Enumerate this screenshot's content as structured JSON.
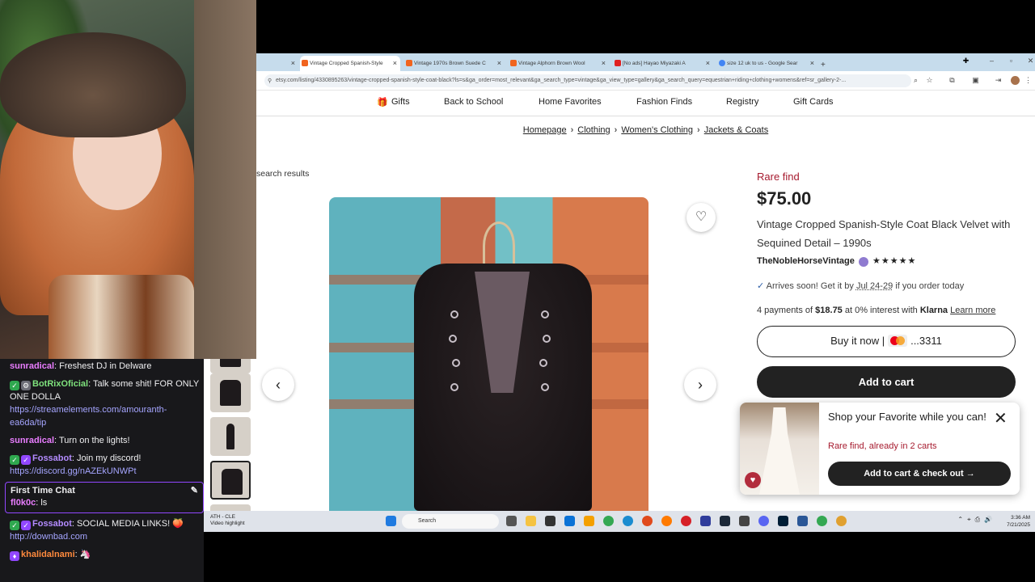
{
  "chat": {
    "messages": [
      {
        "user": "sunradical",
        "text": ": Freshest DJ in Delware"
      },
      {
        "user": "BotRixOficial",
        "text": ": Talk some shit! FOR ONLY ONE DOLLA",
        "link": "https://streamelements.com/amouranth-ea6da/tip"
      },
      {
        "user": "sunradical",
        "text": ": Turn on the lights!"
      },
      {
        "user": "Fossabot",
        "text": ": Join my discord!",
        "link": "https://discord.gg/nAZEkUNWPt"
      },
      {
        "user": "Fossabot",
        "text": ": SOCIAL MEDIA LINKS! 🍑",
        "link": "http://downbad.com"
      },
      {
        "user": "khalidalnami",
        "text": ": 🦄"
      }
    ],
    "first_time": {
      "header": "First Time Chat",
      "user": "fl0k0c",
      "text": ": ls"
    }
  },
  "browser": {
    "tabs": [
      {
        "label": "Vintage Cropped Spanish-Style"
      },
      {
        "label": "Vintage 1970s Brown Suede C"
      },
      {
        "label": "Vintage Alphorn Brown Wool"
      },
      {
        "label": "[No ads] Hayao Miyazaki A"
      },
      {
        "label": "size 12 uk to us - Google Sear"
      }
    ],
    "new_tab": "+",
    "url": "etsy.com/listing/4330895263/vintage-cropped-spanish-style-coat-black?ls=s&ga_order=most_relevant&ga_search_type=vintage&ga_view_type=gallery&ga_search_query=equestrian+riding+clothing+womens&ref=sr_gallery-2-..."
  },
  "nav": {
    "items": [
      "Gifts",
      "Back to School",
      "Home Favorites",
      "Fashion Finds",
      "Registry",
      "Gift Cards"
    ]
  },
  "breadcrumb": [
    "Homepage",
    "Clothing",
    "Women's Clothing",
    "Jackets & Coats"
  ],
  "back_link": "search results",
  "product": {
    "rare": "Rare find",
    "price": "$75.00",
    "title": "Vintage Cropped Spanish-Style Coat Black Velvet with Sequined Detail – 1990s",
    "shop": "TheNobleHorseVintage",
    "stars": "★★★★★",
    "arrives_pre": "Arrives soon! Get it by ",
    "arrives_date": "Jul 24-29",
    "arrives_post": " if you order today",
    "klarna_pre": "4 payments of ",
    "klarna_amount": "$18.75",
    "klarna_mid": " at 0% interest with ",
    "klarna_brand": "Klarna",
    "klarna_more": "Learn more",
    "buy_now": "Buy it now |",
    "card_last4": "...3311",
    "add_to_cart": "Add to cart"
  },
  "popup": {
    "title": "Shop your Favorite while you can!",
    "subtitle": "Rare find, already in 2 carts",
    "button": "Add to cart & check out →",
    "close": "✕"
  },
  "taskbar": {
    "news_title": "ATH - CLE",
    "news_sub": "Video highlight",
    "search": "Search",
    "time": "3:36 AM",
    "date": "7/21/2025"
  },
  "colors": {
    "accent": "#a61a2e",
    "dark": "#222222",
    "tabbar": "#c6dcec"
  },
  "icons": [
    "heart-icon",
    "chevron-left-icon",
    "chevron-right-icon",
    "check-icon",
    "gift-icon",
    "search-icon",
    "close-icon"
  ]
}
